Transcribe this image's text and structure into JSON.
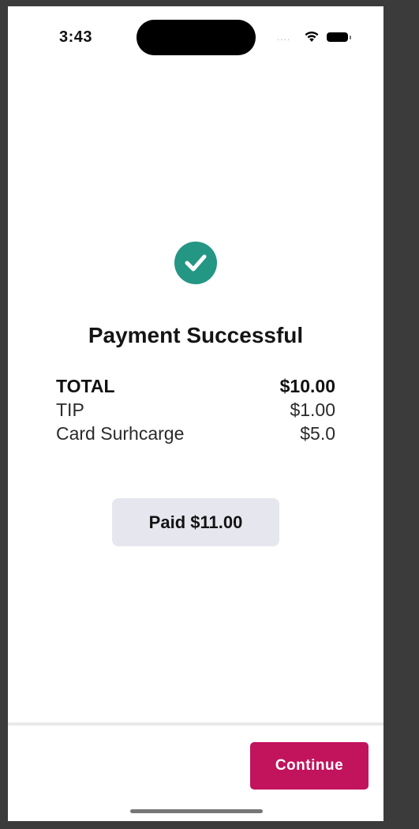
{
  "status_bar": {
    "time": "3:43",
    "signal_dots": "....",
    "wifi_icon": "wifi-icon",
    "battery_icon": "battery-icon"
  },
  "success": {
    "icon": "check-circle-icon",
    "icon_color": "#249684",
    "title": "Payment Successful"
  },
  "summary": {
    "rows": [
      {
        "label": "TOTAL",
        "value": "$10.00"
      },
      {
        "label": "TIP",
        "value": "$1.00"
      },
      {
        "label": "Card Surhcarge",
        "value": "$5.0"
      }
    ]
  },
  "paid_button": {
    "label": "Paid $11.00",
    "color": "#e6e6ee"
  },
  "footer": {
    "continue_label": "Continue",
    "continue_color": "#c2135d"
  }
}
